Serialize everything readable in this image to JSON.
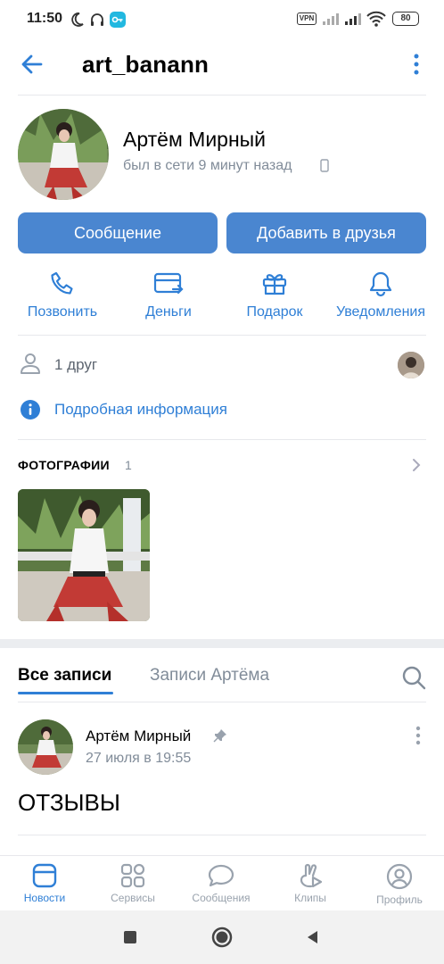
{
  "status_bar": {
    "time": "11:50",
    "vpn": "VPN",
    "battery": "80"
  },
  "header": {
    "title": "art_banann"
  },
  "profile": {
    "name": "Артём Мирный",
    "last_seen": "был в сети 9 минут назад"
  },
  "buttons": {
    "message": "Сообщение",
    "add_friend": "Добавить в друзья"
  },
  "actions": [
    {
      "label": "Позвонить",
      "icon": "phone-icon"
    },
    {
      "label": "Деньги",
      "icon": "money-card-icon"
    },
    {
      "label": "Подарок",
      "icon": "gift-icon"
    },
    {
      "label": "Уведомления",
      "icon": "bell-icon"
    }
  ],
  "info": {
    "friends": "1 друг",
    "details": "Подробная информация"
  },
  "photos": {
    "title": "ФОТОГРАФИИ",
    "count": "1"
  },
  "wall_tabs": {
    "all": "Все записи",
    "own": "Записи Артёма"
  },
  "post": {
    "author": "Артём Мирный",
    "date": "27 июля в 19:55",
    "text": "ОТЗЫВЫ"
  },
  "tab_bar": [
    {
      "label": "Новости",
      "icon": "news-icon",
      "active": true
    },
    {
      "label": "Сервисы",
      "icon": "services-icon",
      "active": false
    },
    {
      "label": "Сообщения",
      "icon": "messages-icon",
      "active": false
    },
    {
      "label": "Клипы",
      "icon": "clips-icon",
      "active": false
    },
    {
      "label": "Профиль",
      "icon": "profile-icon",
      "active": false
    }
  ],
  "colors": {
    "accent": "#2f7fd6",
    "button": "#4a86d0",
    "muted": "#818c99"
  }
}
